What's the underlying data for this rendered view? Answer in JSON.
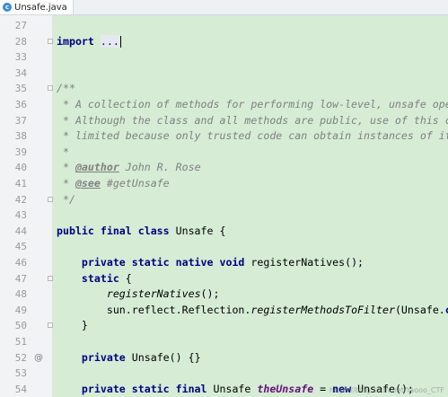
{
  "tab": {
    "label": "Unsafe.java",
    "icon": "java-class-icon"
  },
  "lines": [
    {
      "n": "27",
      "code": "",
      "mark": ""
    },
    {
      "n": "28",
      "code": "import ...",
      "mark": ""
    },
    {
      "n": "33",
      "code": "",
      "mark": ""
    },
    {
      "n": "34",
      "code": "",
      "mark": ""
    },
    {
      "n": "35",
      "code": "/**",
      "mark": ""
    },
    {
      "n": "36",
      "code": " * A collection of methods for performing low-level, unsafe operations.",
      "mark": ""
    },
    {
      "n": "37",
      "code": " * Although the class and all methods are public, use of this class is",
      "mark": ""
    },
    {
      "n": "38",
      "code": " * limited because only trusted code can obtain instances of it.",
      "mark": ""
    },
    {
      "n": "39",
      "code": " *",
      "mark": ""
    },
    {
      "n": "40",
      "code": " * @author John R. Rose",
      "mark": ""
    },
    {
      "n": "41",
      "code": " * @see #getUnsafe",
      "mark": ""
    },
    {
      "n": "42",
      "code": " */",
      "mark": ""
    },
    {
      "n": "43",
      "code": "",
      "mark": ""
    },
    {
      "n": "44",
      "code": "public final class Unsafe {",
      "mark": ""
    },
    {
      "n": "45",
      "code": "",
      "mark": ""
    },
    {
      "n": "46",
      "code": "    private static native void registerNatives();",
      "mark": ""
    },
    {
      "n": "47",
      "code": "    static {",
      "mark": ""
    },
    {
      "n": "48",
      "code": "        registerNatives();",
      "mark": ""
    },
    {
      "n": "49",
      "code": "        sun.reflect.Reflection.registerMethodsToFilter(Unsafe.class, \"getUnsafe\");",
      "mark": ""
    },
    {
      "n": "50",
      "code": "    }",
      "mark": ""
    },
    {
      "n": "51",
      "code": "",
      "mark": ""
    },
    {
      "n": "52",
      "code": "    private Unsafe() {}",
      "mark": "@"
    },
    {
      "n": "53",
      "code": "",
      "mark": ""
    },
    {
      "n": "54",
      "code": "    private static final Unsafe theUnsafe = new Unsafe();",
      "mark": ""
    }
  ],
  "watermark": "https://blog.csdn.net/Yaooo_CTF"
}
